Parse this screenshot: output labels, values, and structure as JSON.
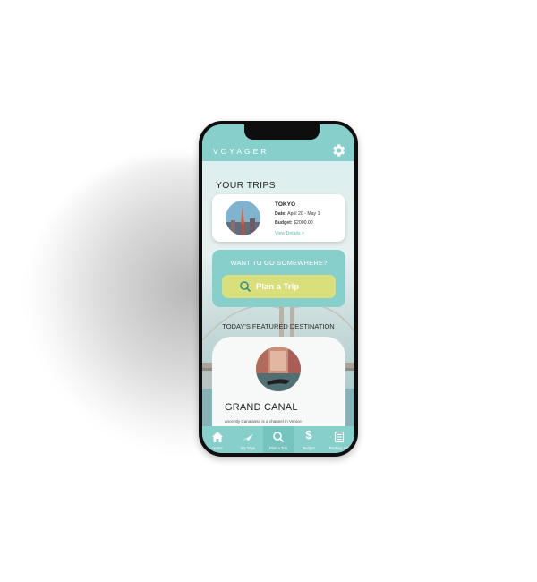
{
  "app": {
    "logo": "VOYAGER"
  },
  "trips": {
    "section_title": "YOUR TRIPS",
    "card": {
      "city": "TOKYO",
      "date_label": "Date:",
      "date_value": "April 20 - May 1",
      "budget_label": "Budget:",
      "budget_value": "$2000.00",
      "link": "View Details >"
    }
  },
  "plan": {
    "question": "WANT TO GO SOMEWHERE?",
    "button_label": "Plan a Trip"
  },
  "featured": {
    "section_title": "TODAY'S FEATURED DESTINATION",
    "name": "GRAND CANAL",
    "description": "ancently Canalasso is a channel in Venice"
  },
  "tabs": [
    {
      "label": "Home",
      "icon": "home-icon"
    },
    {
      "label": "My Trips",
      "icon": "plane-icon"
    },
    {
      "label": "Plan a Trip",
      "icon": "search-icon"
    },
    {
      "label": "Budget",
      "icon": "dollar-icon"
    },
    {
      "label": "Packing List",
      "icon": "list-icon"
    }
  ],
  "colors": {
    "primary": "#86cfcb",
    "accent": "#d8df7b",
    "link": "#5fb9b2"
  }
}
